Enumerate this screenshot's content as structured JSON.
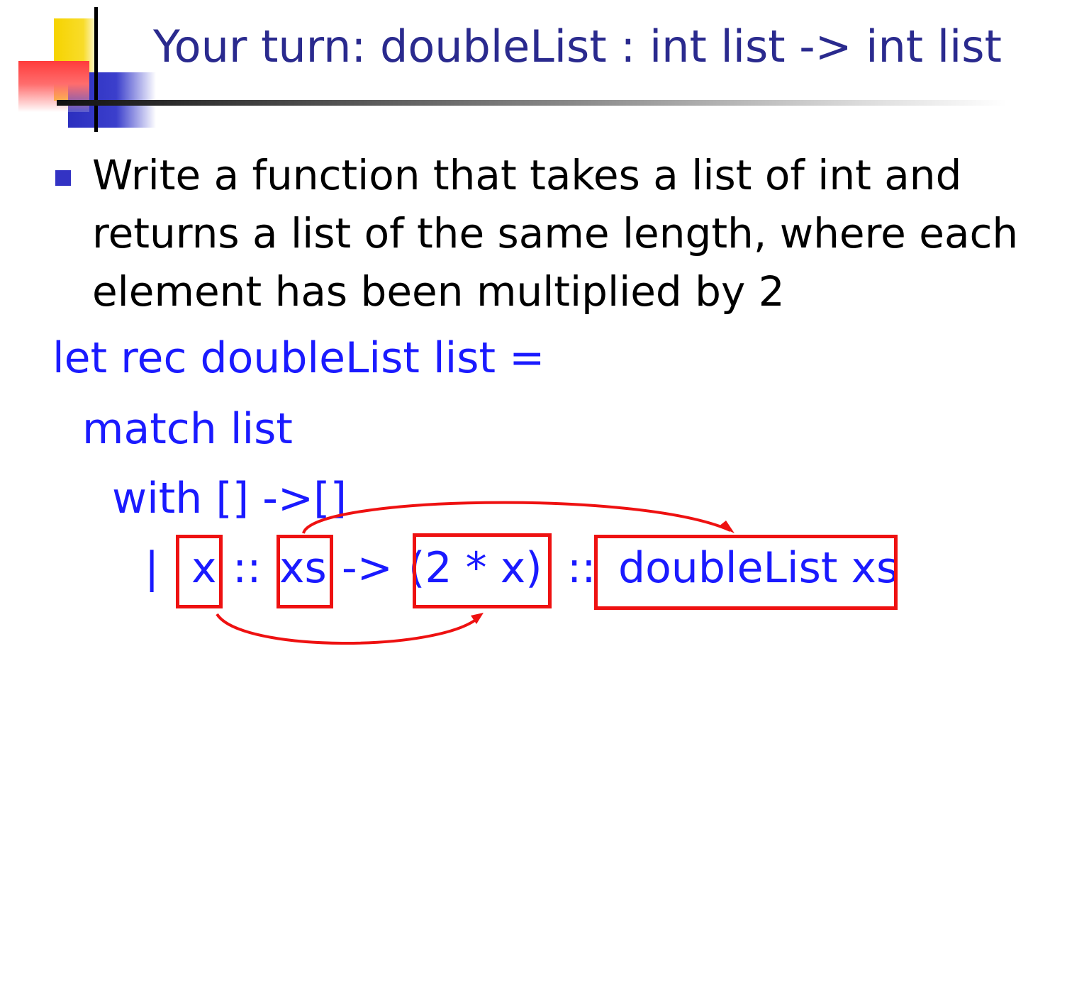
{
  "slide": {
    "title": "Your turn: doubleList : int list -> int list",
    "bullet": "Write a function that takes a list of int and returns a list of the same length, where each element has been multiplied by 2",
    "code": {
      "line1": "let rec doubleList list =",
      "line2": "match list",
      "line3": "with [] ->[]",
      "line4": {
        "bar": "|",
        "x": "x",
        "cons1": "::",
        "xs": "xs",
        "arrow": "->",
        "double_expr": "(2 * x)",
        "cons2": "::",
        "recursive_call": "doubleList xs"
      }
    },
    "colors": {
      "title": "#2a2a8e",
      "code": "#1a1aff",
      "annotation": "#ee1111",
      "bullet_marker": "#3333c4"
    }
  }
}
